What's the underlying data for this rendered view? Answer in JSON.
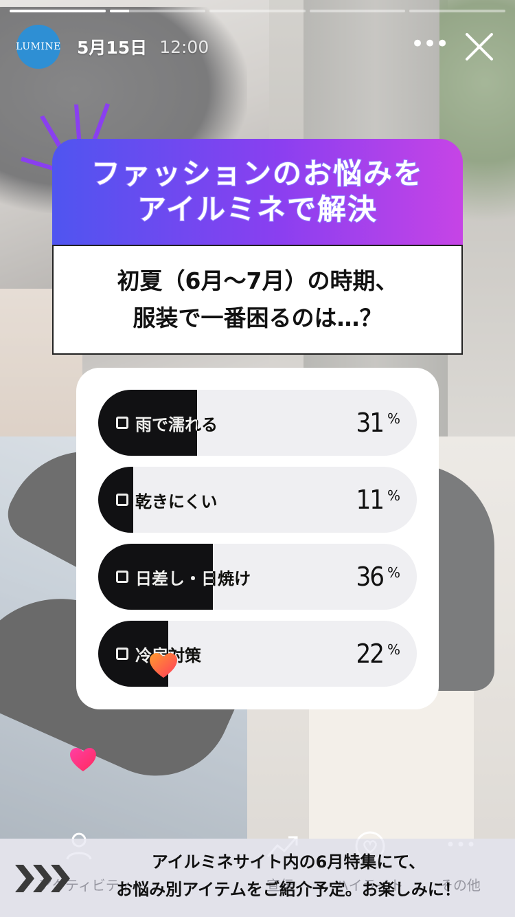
{
  "header": {
    "account_avatar_text": "LUMINE",
    "date": "5月15日",
    "time": "12:00"
  },
  "progress": {
    "total_segments": 5,
    "completed_segments": 1,
    "current_segment_fraction": 0.2
  },
  "banner": {
    "line1": "ファッションのお悩みを",
    "line2": "アイルミネで解決"
  },
  "question": {
    "line1": "初夏（6月〜7月）の時期、",
    "line2": "服装で一番困るのは…？"
  },
  "poll": {
    "options": [
      {
        "label": "雨で濡れる",
        "percent": 31
      },
      {
        "label": "乾きにくい",
        "percent": 11
      },
      {
        "label": "日差し・日焼け",
        "percent": 36
      },
      {
        "label": "冷房対策",
        "percent": 22
      }
    ],
    "percent_sign": "%"
  },
  "bottom": {
    "labels": [
      "アクティビティ",
      "宣伝",
      "ハイライト",
      "その他"
    ],
    "notice_line1": "アイルミネサイト内の6月特集にて、",
    "notice_line2": "お悩み別アイテムをご紹介予定。お楽しみに！"
  },
  "colors": {
    "brand_blue": "#2e8fd4",
    "banner_gradient_start": "#4f55f0",
    "banner_gradient_end": "#c644e6",
    "poll_fill": "#111113",
    "poll_track": "#efeff2"
  },
  "icons": [
    "more-icon",
    "close-icon",
    "activity-icon",
    "promote-icon",
    "highlight-icon",
    "more-options-icon",
    "chevron-arrows-icon",
    "heart-reaction-icon"
  ]
}
